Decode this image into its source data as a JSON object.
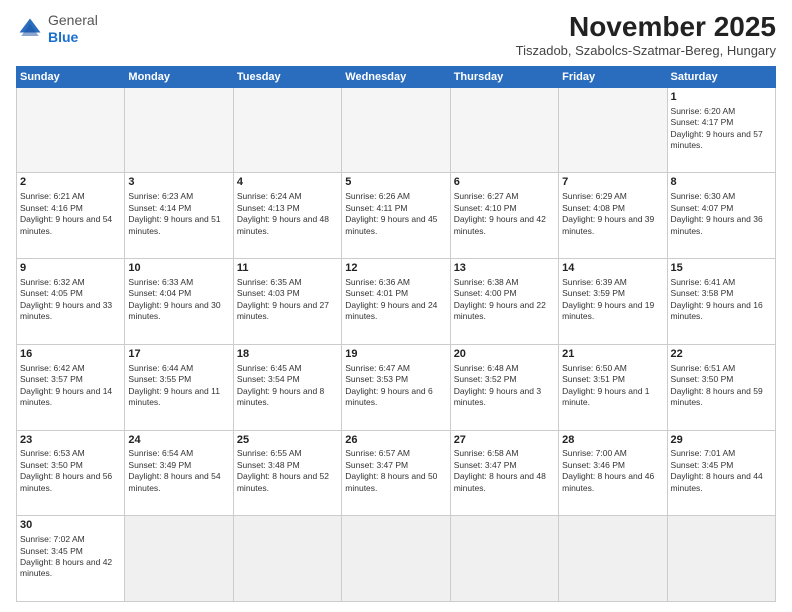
{
  "header": {
    "logo": {
      "general": "General",
      "blue": "Blue"
    },
    "title": "November 2025",
    "location": "Tiszadob, Szabolcs-Szatmar-Bereg, Hungary"
  },
  "weekdays": [
    "Sunday",
    "Monday",
    "Tuesday",
    "Wednesday",
    "Thursday",
    "Friday",
    "Saturday"
  ],
  "weeks": [
    [
      {
        "day": "",
        "empty": true
      },
      {
        "day": "",
        "empty": true
      },
      {
        "day": "",
        "empty": true
      },
      {
        "day": "",
        "empty": true
      },
      {
        "day": "",
        "empty": true
      },
      {
        "day": "",
        "empty": true
      },
      {
        "day": "1",
        "sunrise": "6:20 AM",
        "sunset": "4:17 PM",
        "daylight": "9 hours and 57 minutes."
      }
    ],
    [
      {
        "day": "2",
        "sunrise": "6:21 AM",
        "sunset": "4:16 PM",
        "daylight": "9 hours and 54 minutes."
      },
      {
        "day": "3",
        "sunrise": "6:23 AM",
        "sunset": "4:14 PM",
        "daylight": "9 hours and 51 minutes."
      },
      {
        "day": "4",
        "sunrise": "6:24 AM",
        "sunset": "4:13 PM",
        "daylight": "9 hours and 48 minutes."
      },
      {
        "day": "5",
        "sunrise": "6:26 AM",
        "sunset": "4:11 PM",
        "daylight": "9 hours and 45 minutes."
      },
      {
        "day": "6",
        "sunrise": "6:27 AM",
        "sunset": "4:10 PM",
        "daylight": "9 hours and 42 minutes."
      },
      {
        "day": "7",
        "sunrise": "6:29 AM",
        "sunset": "4:08 PM",
        "daylight": "9 hours and 39 minutes."
      },
      {
        "day": "8",
        "sunrise": "6:30 AM",
        "sunset": "4:07 PM",
        "daylight": "9 hours and 36 minutes."
      }
    ],
    [
      {
        "day": "9",
        "sunrise": "6:32 AM",
        "sunset": "4:05 PM",
        "daylight": "9 hours and 33 minutes."
      },
      {
        "day": "10",
        "sunrise": "6:33 AM",
        "sunset": "4:04 PM",
        "daylight": "9 hours and 30 minutes."
      },
      {
        "day": "11",
        "sunrise": "6:35 AM",
        "sunset": "4:03 PM",
        "daylight": "9 hours and 27 minutes."
      },
      {
        "day": "12",
        "sunrise": "6:36 AM",
        "sunset": "4:01 PM",
        "daylight": "9 hours and 24 minutes."
      },
      {
        "day": "13",
        "sunrise": "6:38 AM",
        "sunset": "4:00 PM",
        "daylight": "9 hours and 22 minutes."
      },
      {
        "day": "14",
        "sunrise": "6:39 AM",
        "sunset": "3:59 PM",
        "daylight": "9 hours and 19 minutes."
      },
      {
        "day": "15",
        "sunrise": "6:41 AM",
        "sunset": "3:58 PM",
        "daylight": "9 hours and 16 minutes."
      }
    ],
    [
      {
        "day": "16",
        "sunrise": "6:42 AM",
        "sunset": "3:57 PM",
        "daylight": "9 hours and 14 minutes."
      },
      {
        "day": "17",
        "sunrise": "6:44 AM",
        "sunset": "3:55 PM",
        "daylight": "9 hours and 11 minutes."
      },
      {
        "day": "18",
        "sunrise": "6:45 AM",
        "sunset": "3:54 PM",
        "daylight": "9 hours and 8 minutes."
      },
      {
        "day": "19",
        "sunrise": "6:47 AM",
        "sunset": "3:53 PM",
        "daylight": "9 hours and 6 minutes."
      },
      {
        "day": "20",
        "sunrise": "6:48 AM",
        "sunset": "3:52 PM",
        "daylight": "9 hours and 3 minutes."
      },
      {
        "day": "21",
        "sunrise": "6:50 AM",
        "sunset": "3:51 PM",
        "daylight": "9 hours and 1 minute."
      },
      {
        "day": "22",
        "sunrise": "6:51 AM",
        "sunset": "3:50 PM",
        "daylight": "8 hours and 59 minutes."
      }
    ],
    [
      {
        "day": "23",
        "sunrise": "6:53 AM",
        "sunset": "3:50 PM",
        "daylight": "8 hours and 56 minutes."
      },
      {
        "day": "24",
        "sunrise": "6:54 AM",
        "sunset": "3:49 PM",
        "daylight": "8 hours and 54 minutes."
      },
      {
        "day": "25",
        "sunrise": "6:55 AM",
        "sunset": "3:48 PM",
        "daylight": "8 hours and 52 minutes."
      },
      {
        "day": "26",
        "sunrise": "6:57 AM",
        "sunset": "3:47 PM",
        "daylight": "8 hours and 50 minutes."
      },
      {
        "day": "27",
        "sunrise": "6:58 AM",
        "sunset": "3:47 PM",
        "daylight": "8 hours and 48 minutes."
      },
      {
        "day": "28",
        "sunrise": "7:00 AM",
        "sunset": "3:46 PM",
        "daylight": "8 hours and 46 minutes."
      },
      {
        "day": "29",
        "sunrise": "7:01 AM",
        "sunset": "3:45 PM",
        "daylight": "8 hours and 44 minutes."
      }
    ],
    [
      {
        "day": "30",
        "sunrise": "7:02 AM",
        "sunset": "3:45 PM",
        "daylight": "8 hours and 42 minutes."
      },
      {
        "day": "",
        "empty": true
      },
      {
        "day": "",
        "empty": true
      },
      {
        "day": "",
        "empty": true
      },
      {
        "day": "",
        "empty": true
      },
      {
        "day": "",
        "empty": true
      },
      {
        "day": "",
        "empty": true
      }
    ]
  ]
}
